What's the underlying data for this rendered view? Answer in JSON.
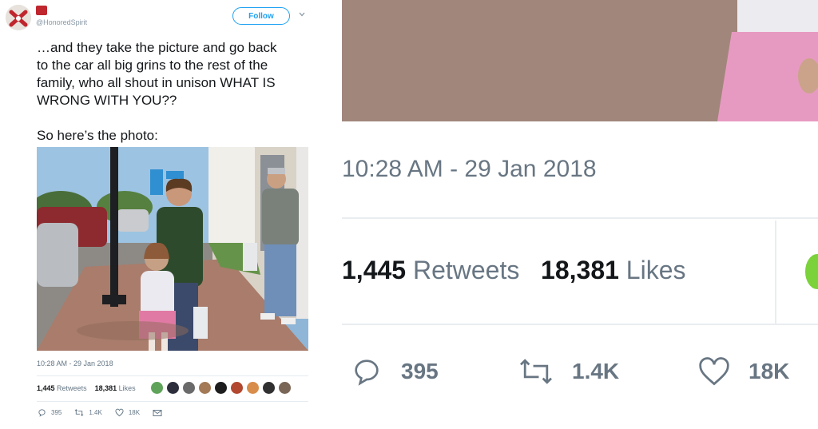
{
  "tweet": {
    "handle": "@HonoredSpirit",
    "follow_label": "Follow",
    "text_lines": [
      "…and they take the picture and go back",
      "to the car all big grins to the rest of the",
      "family, who all shout in unison WHAT IS",
      "WRONG WITH YOU??"
    ],
    "text_photo_intro": "So here’s the photo:",
    "timestamp": "10:28 AM - 29 Jan 2018",
    "retweets_count": "1,445",
    "retweets_label": "Retweets",
    "likes_count": "18,381",
    "likes_label": "Likes",
    "reply_count": "395",
    "retweet_action_count": "1.4K",
    "like_action_count": "18K"
  },
  "zoom": {
    "timestamp": "10:28 AM - 29 Jan 2018",
    "retweets_count": "1,445",
    "retweets_label": "Retweets",
    "likes_count": "18,381",
    "likes_label": "Likes",
    "reply_count": "395",
    "retweet_action_count": "1.4K",
    "like_action_count": "18K"
  },
  "colors": {
    "accent": "#1da1f2",
    "muted": "#657786",
    "text": "#14171a"
  },
  "icons": [
    "avatar",
    "follow-caret-icon",
    "reply-icon",
    "retweet-icon",
    "like-icon",
    "message-icon"
  ]
}
